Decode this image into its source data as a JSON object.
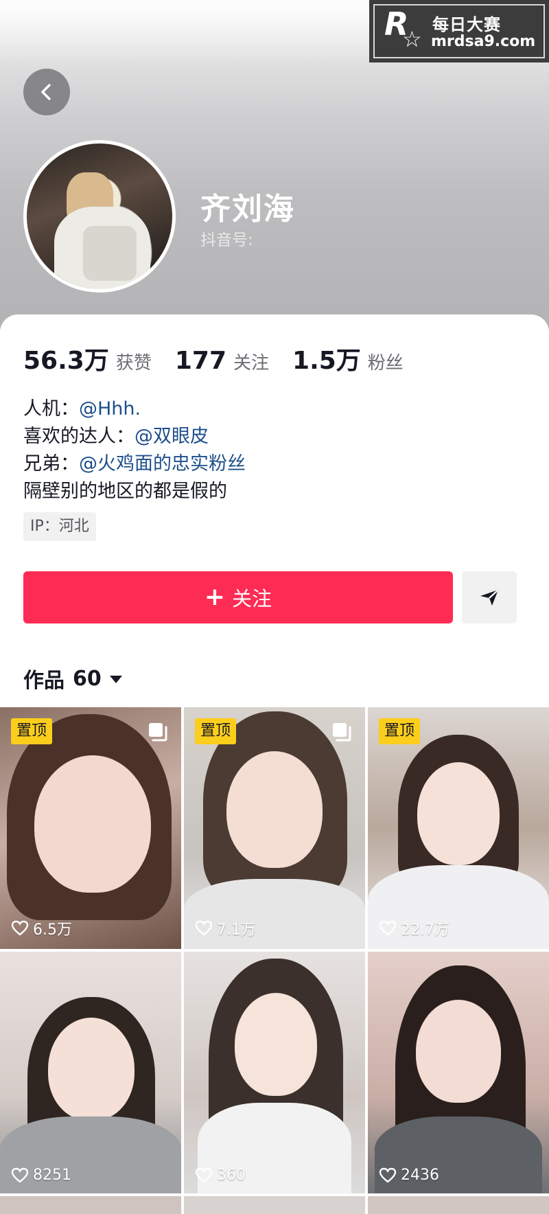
{
  "watermark": {
    "logo_letter": "R",
    "cn": "每日大赛",
    "site": "mrdsa9.com"
  },
  "profile": {
    "name": "齐刘海",
    "douyin_id_label": "抖音号:"
  },
  "stats": [
    {
      "value": "56.3万",
      "label": "获赞"
    },
    {
      "value": "177",
      "label": "关注"
    },
    {
      "value": "1.5万",
      "label": "粉丝"
    }
  ],
  "bio": {
    "line1_prefix": "人机：",
    "line1_mention": "@Hhh.",
    "line2_prefix": "喜欢的达人：",
    "line2_mention": "@双眼皮",
    "line3_prefix": "兄弟：",
    "line3_mention": "@火鸡面的忠实粉丝",
    "line4": "隔壁别的地区的都是假的"
  },
  "ip_tag": "IP：河北",
  "actions": {
    "follow_label": "关注",
    "follow_plus": "+"
  },
  "works": {
    "label": "作品",
    "count": "60"
  },
  "videos": [
    {
      "pinned_label": "置顶",
      "likes": "6.5万",
      "multi": true
    },
    {
      "pinned_label": "置顶",
      "likes": "7.1万",
      "multi": true
    },
    {
      "pinned_label": "置顶",
      "likes": "22.7万",
      "multi": false
    },
    {
      "pinned_label": "",
      "likes": "8251",
      "multi": false
    },
    {
      "pinned_label": "",
      "likes": "360",
      "multi": false
    },
    {
      "pinned_label": "",
      "likes": "2436",
      "multi": false
    }
  ],
  "colors": {
    "accent": "#fe2c55",
    "pin": "#fcce1c",
    "mention": "#1c4e8a"
  },
  "icons": {
    "back": "chevron-left-icon",
    "share": "send-icon",
    "likes": "heart-icon",
    "multi": "stack-icon",
    "caret": "caret-down-icon"
  }
}
